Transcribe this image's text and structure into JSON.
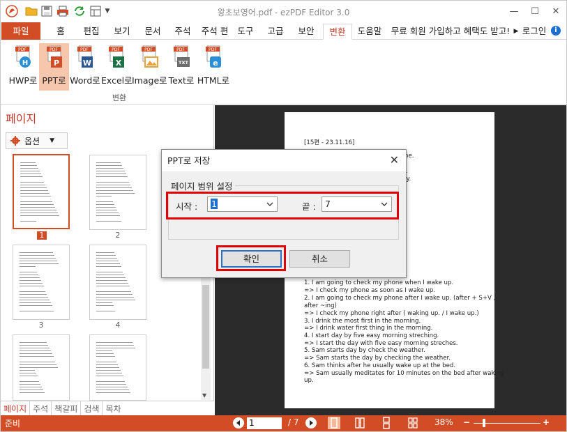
{
  "window": {
    "title": "왕초보영어.pdf - ezPDF Editor 3.0",
    "minimize": "—",
    "maximize": "☐",
    "close": "✕"
  },
  "ribbon_tabs": [
    "파일",
    "홈",
    "편집",
    "보기",
    "문서",
    "주석",
    "주석 편",
    "도구",
    "고급",
    "보안",
    "변환",
    "도움말",
    "무료 회원 가입하고 혜택도 받고!",
    "로그인"
  ],
  "ribbon": {
    "active_tab": "변환",
    "group_label": "변환",
    "buttons": [
      {
        "label": "HWP로",
        "badge": "PDF",
        "sub": "H",
        "color": "#2a8fd6"
      },
      {
        "label": "PPT로",
        "badge": "PDF",
        "sub": "P",
        "color": "#d24d26"
      },
      {
        "label": "Word로",
        "badge": "PDF",
        "sub": "W",
        "color": "#2b5797"
      },
      {
        "label": "Excel로",
        "badge": "PDF",
        "sub": "X",
        "color": "#1e7145"
      },
      {
        "label": "Image로",
        "badge": "PDF",
        "sub": "▲",
        "color": "#e8a33c"
      },
      {
        "label": "Text로",
        "badge": "PDF",
        "sub": "TXT",
        "color": "#6d6d6d"
      },
      {
        "label": "HTML로",
        "badge": "PDF",
        "sub": "e",
        "color": "#2a8fd6"
      }
    ]
  },
  "left_panel": {
    "title": "페이지",
    "options_label": "옵션",
    "thumbnails": [
      "1",
      "2",
      "3",
      "4"
    ],
    "bottom_tabs": [
      "페이지",
      "주석",
      "책갈피",
      "검색",
      "목차"
    ]
  },
  "document": {
    "header": "[15편 - 23.11.16]",
    "partial_lines": [
      "ne.",
      "y.",
      "irity."
    ],
    "lines": [
      "1. I am going to check my phone when I wake up.",
      "=> I check my phone as soon as I wake up.",
      "2. I am going to check my phone after I wake up. (after + S+V ,",
      "after ~ing)",
      "=> I check my phone right after  ( waking up. / I wake up.)",
      "3. I drink the most first in the morning.",
      "=> I drink water first thing in the morning.",
      "4. I start day by five easy morning streching.",
      "=> I start the day with five easy morning streches.",
      "5. Sam starts day by check the weather.",
      "=> Sam starts the day by checking the weather.",
      "6. Sam thinks after he usually wake up at the bed.",
      "=> Sam usually meditates for 10 minutes on the bed after waking",
      "up."
    ]
  },
  "dialog": {
    "title": "PPT로 저장",
    "group_label": "페이지 범위 설정",
    "start_label": "시작 :",
    "start_value": "1",
    "end_label": "끝 :",
    "end_value": "7",
    "ok_label": "확인",
    "cancel_label": "취소"
  },
  "status": {
    "ready": "준비",
    "page_input": "1",
    "page_total": "/ 7",
    "zoom": "38%",
    "zoom_level": 0.38,
    "accent": "#d24d26"
  }
}
